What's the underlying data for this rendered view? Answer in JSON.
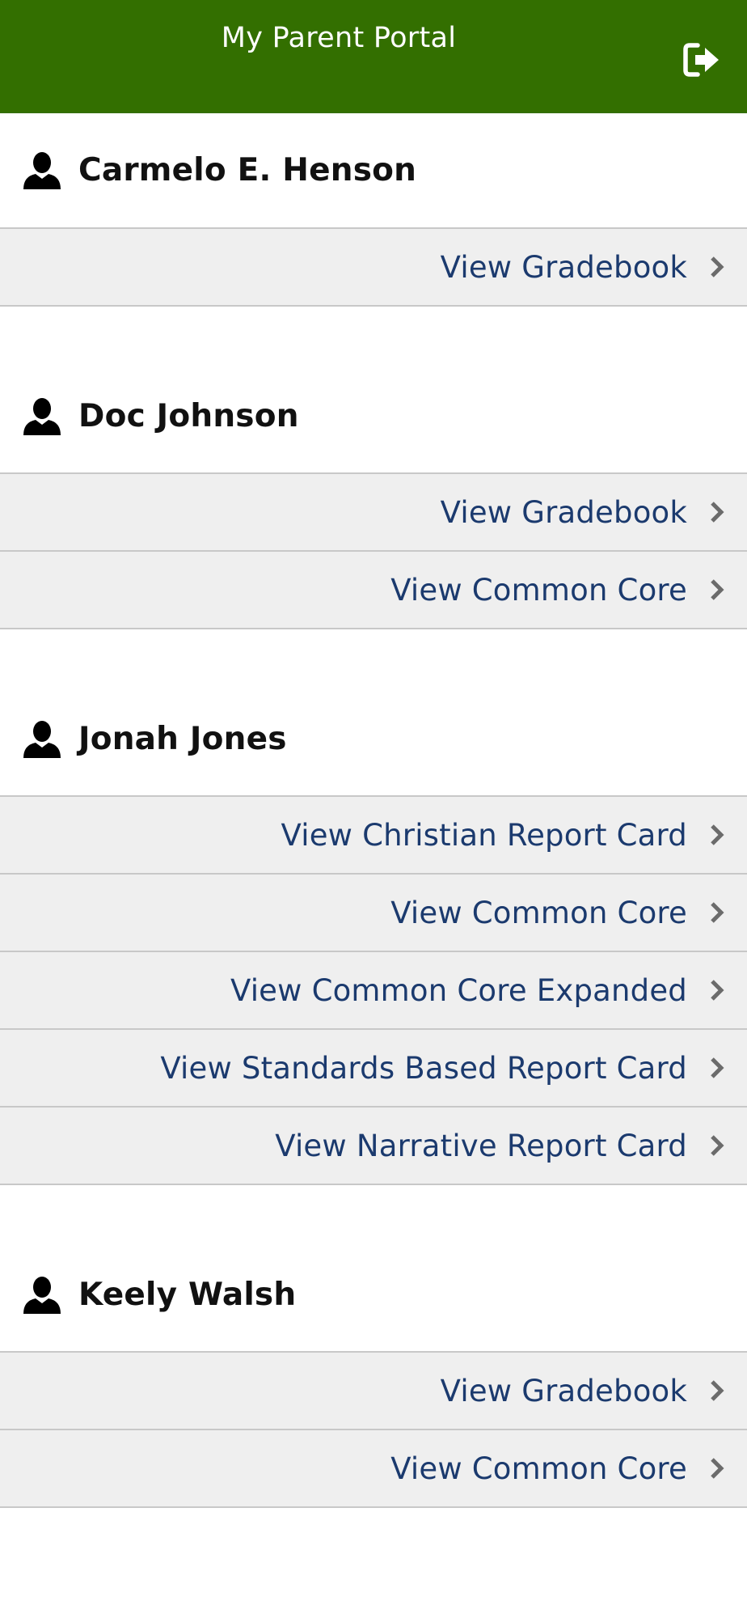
{
  "app": {
    "title": "My Parent Portal",
    "header_color": "#336f00",
    "logout_icon": "sign-out-icon"
  },
  "students": [
    {
      "name": "Carmelo E. Henson",
      "links": [
        {
          "label": "View Gradebook"
        }
      ]
    },
    {
      "name": "Doc Johnson",
      "links": [
        {
          "label": "View Gradebook"
        },
        {
          "label": "View Common Core"
        }
      ]
    },
    {
      "name": "Jonah Jones",
      "links": [
        {
          "label": "View Christian Report Card"
        },
        {
          "label": "View Common Core"
        },
        {
          "label": "View Common Core Expanded"
        },
        {
          "label": "View Standards Based Report Card"
        },
        {
          "label": "View Narrative Report Card"
        }
      ]
    },
    {
      "name": "Keely Walsh",
      "links": [
        {
          "label": "View Gradebook"
        },
        {
          "label": "View Common Core"
        }
      ]
    }
  ]
}
